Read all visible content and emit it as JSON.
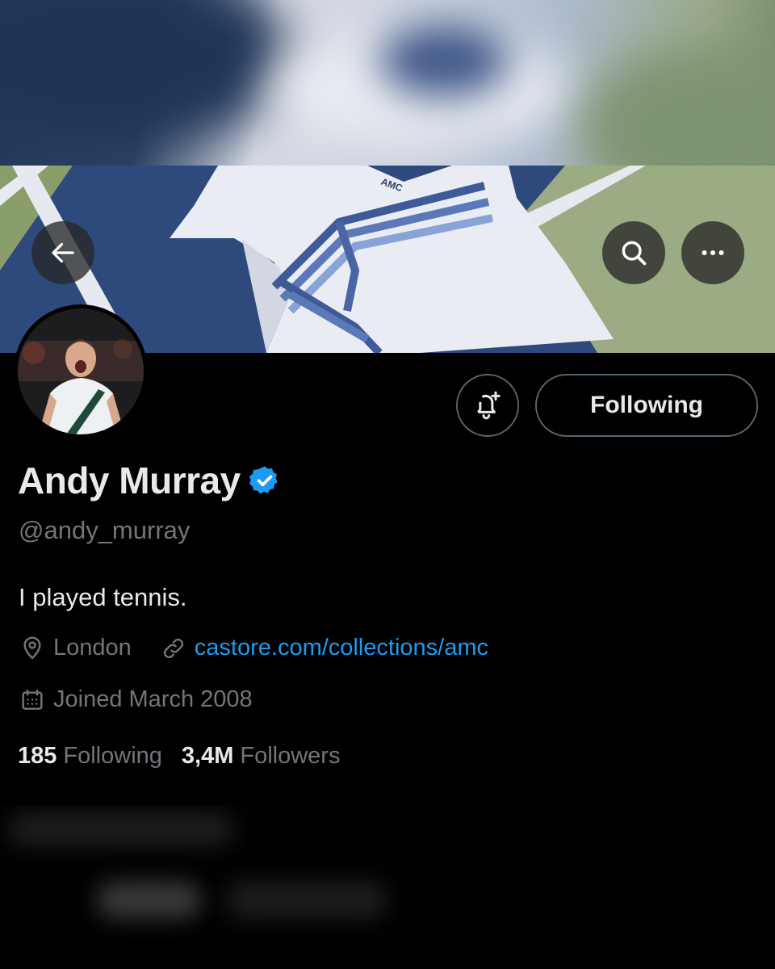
{
  "header": {
    "back_icon": "arrow-left-icon",
    "search_icon": "search-icon",
    "more_icon": "more-horizontal-icon"
  },
  "banner": {
    "shirt_logo_text": "AMC"
  },
  "actions": {
    "notify_icon": "bell-plus-icon",
    "following_label": "Following"
  },
  "profile": {
    "name": "Andy Murray",
    "verified_icon": "verified-badge-icon",
    "handle": "@andy_murray",
    "bio": "I played tennis.",
    "location": "London",
    "location_icon": "location-pin-icon",
    "website": "castore.com/collections/amc",
    "website_icon": "link-icon",
    "joined": "Joined March 2008",
    "joined_icon": "calendar-icon"
  },
  "stats": {
    "following_count": "185",
    "following_label": "Following",
    "followers_count": "3,4M",
    "followers_label": "Followers"
  },
  "colors": {
    "background": "#000000",
    "accent": "#1d9bf0",
    "text_primary": "#e7e9ea",
    "text_secondary": "#71767b",
    "border": "#536471"
  }
}
